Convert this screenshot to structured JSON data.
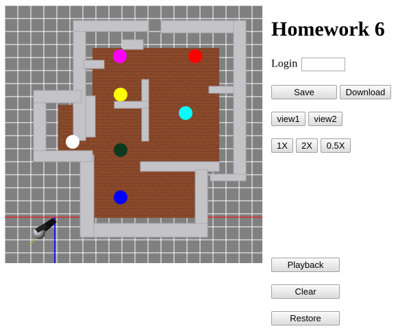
{
  "header": {
    "title": "Homework 6"
  },
  "login": {
    "label": "Login",
    "value": ""
  },
  "buttons": {
    "save": "Save",
    "download": "Download",
    "view1": "view1",
    "view2": "view2",
    "zoom_1x": "1X",
    "zoom_2x": "2X",
    "zoom_05x": "0.5X",
    "playback": "Playback",
    "clear": "Clear",
    "restore": "Restore"
  },
  "scene": {
    "background_color": "#808080",
    "grid_color": "#ffffff",
    "axis_x_color": "#ff0000",
    "axis_y_color": "#0000ff",
    "floor_color": "#8b4a2b",
    "wall_color": "#c4c4c8",
    "markers": [
      {
        "name": "magenta",
        "color": "#ff00ff"
      },
      {
        "name": "red",
        "color": "#ff0000"
      },
      {
        "name": "yellow",
        "color": "#ffff00"
      },
      {
        "name": "cyan",
        "color": "#00ffff"
      },
      {
        "name": "white",
        "color": "#ffffff"
      },
      {
        "name": "dark-green",
        "color": "#0d3a1f"
      },
      {
        "name": "blue",
        "color": "#0000ff"
      }
    ],
    "robot_icon": "robot-camera-icon"
  }
}
